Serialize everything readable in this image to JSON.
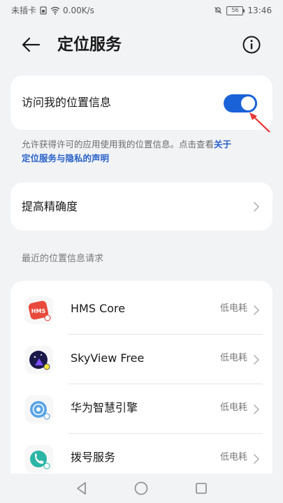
{
  "status_bar": {
    "carrier": "未插卡",
    "network_speed": "0.00K/s",
    "battery": "56",
    "time": "13:46"
  },
  "header": {
    "title": "定位服务"
  },
  "location_access": {
    "label": "访问我的位置信息",
    "enabled": true
  },
  "description": {
    "text": "允许获得许可的应用使用我的位置信息。点击查看",
    "link_part1": "关于",
    "link_part2": "定位服务与隐私的声明"
  },
  "precision": {
    "label": "提高精确度"
  },
  "recent_requests": {
    "section_title": "最近的位置信息请求",
    "apps": [
      {
        "name": "HMS Core",
        "usage": "低电耗",
        "icon": "hms-core-icon"
      },
      {
        "name": "SkyView Free",
        "usage": "低电耗",
        "icon": "skyview-icon"
      },
      {
        "name": "华为智慧引擎",
        "usage": "低电耗",
        "icon": "huawei-smart-engine-icon"
      },
      {
        "name": "拨号服务",
        "usage": "低电耗",
        "icon": "dialer-service-icon"
      }
    ]
  },
  "colors": {
    "accent": "#1a62d8",
    "link": "#2a62c9",
    "background": "#f1f3f5"
  }
}
